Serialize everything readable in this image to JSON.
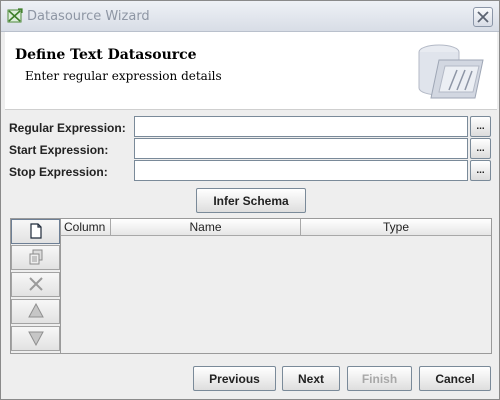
{
  "window": {
    "title": "Datasource Wizard"
  },
  "header": {
    "title": "Define Text Datasource",
    "subtitle": "Enter regular expression details"
  },
  "form": {
    "fields": [
      {
        "label": "Regular Expression:",
        "value": "",
        "button": "..."
      },
      {
        "label": "Start Expression:",
        "value": "",
        "button": "..."
      },
      {
        "label": "Stop Expression:",
        "value": "",
        "button": "..."
      }
    ],
    "infer_label": "Infer Schema"
  },
  "toolbar": {
    "buttons": [
      {
        "icon": "new-document-icon",
        "enabled": true
      },
      {
        "icon": "copy-icon",
        "enabled": false
      },
      {
        "icon": "delete-x-icon",
        "enabled": false
      },
      {
        "icon": "arrow-up-icon",
        "enabled": false
      },
      {
        "icon": "arrow-down-icon",
        "enabled": false
      }
    ]
  },
  "table": {
    "columns": [
      "Column",
      "Name",
      "Type"
    ],
    "rows": []
  },
  "footer": {
    "previous_label": "Previous",
    "next_label": "Next",
    "finish_label": "Finish",
    "cancel_label": "Cancel",
    "finish_enabled": false
  },
  "colors": {
    "disabled_text": "#a8a8a8",
    "header_bg": "#ffffff",
    "dialog_bg": "#eeeeee"
  }
}
